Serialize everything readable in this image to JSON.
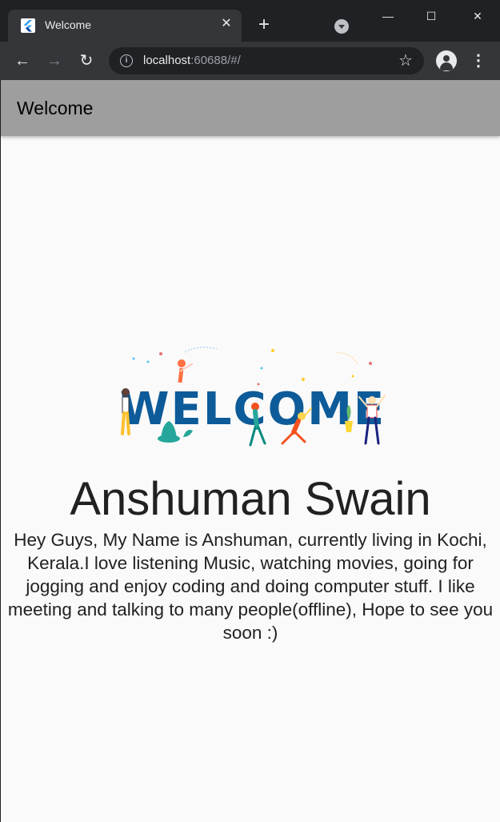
{
  "browser": {
    "tab_title": "Welcome",
    "tab_close": "✕",
    "new_tab": "+",
    "url_host": "localhost",
    "url_rest": ":60688/#/",
    "win_minimize": "—",
    "win_maximize": "☐",
    "win_close": "✕",
    "back": "←",
    "forward": "→",
    "reload": "↻",
    "star": "☆",
    "menu": "⋮"
  },
  "app": {
    "title": "Welcome",
    "hero_text": "WELCOME",
    "name": "Anshuman Swain",
    "bio": "Hey Guys, My Name is Anshuman, currently living in Kochi, Kerala.I love listening Music, watching movies, going for jogging and enjoy coding and doing computer stuff. I like meeting and talking to many people(offline), Hope to see you soon :)"
  },
  "colors": {
    "appbar": "#9e9e9e",
    "welcome_blue": "#0d5b99",
    "background": "#fafafa"
  }
}
